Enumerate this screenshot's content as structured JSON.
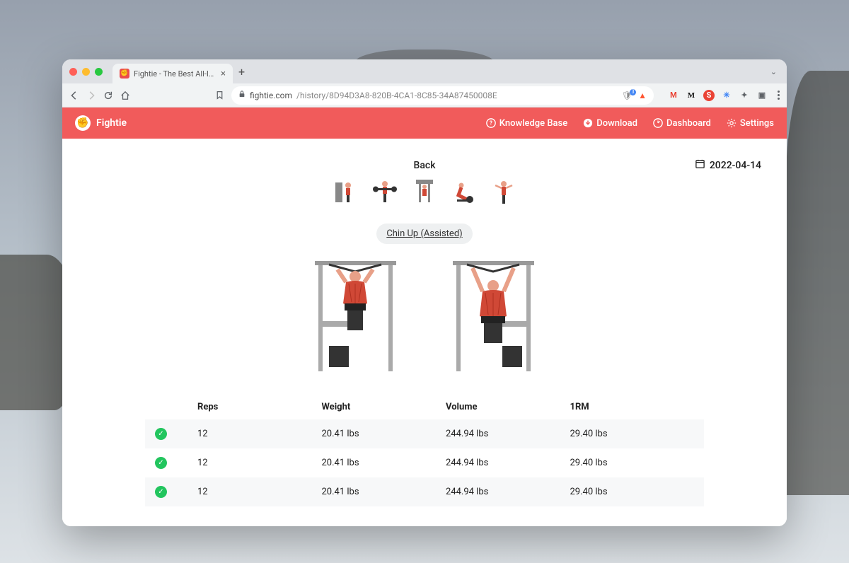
{
  "browser": {
    "tab_title": "Fightie - The Best All-In-One W",
    "url_host": "fightie.com",
    "url_path": "/history/8D94D3A8-820B-4CA1-8C85-34A87450008E"
  },
  "app": {
    "brand": "Fightie",
    "nav": {
      "knowledge_base": "Knowledge Base",
      "download": "Download",
      "dashboard": "Dashboard",
      "settings": "Settings"
    }
  },
  "workout": {
    "date": "2022-04-14",
    "muscle_group": "Back",
    "exercise_name": "Chin Up (Assisted)",
    "columns": {
      "reps": "Reps",
      "weight": "Weight",
      "volume": "Volume",
      "one_rm": "1RM"
    },
    "sets": [
      {
        "reps": "12",
        "weight": "20.41 lbs",
        "volume": "244.94 lbs",
        "one_rm": "29.40 lbs"
      },
      {
        "reps": "12",
        "weight": "20.41 lbs",
        "volume": "244.94 lbs",
        "one_rm": "29.40 lbs"
      },
      {
        "reps": "12",
        "weight": "20.41 lbs",
        "volume": "244.94 lbs",
        "one_rm": "29.40 lbs"
      }
    ]
  }
}
